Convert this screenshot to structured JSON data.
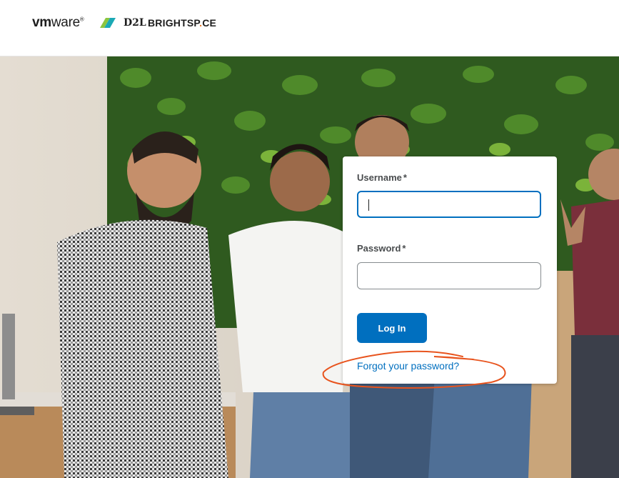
{
  "header": {
    "vmware_logo": {
      "bold": "vm",
      "regular": "ware",
      "mark": "®"
    },
    "d2l_logo": "D2L",
    "brightspace_logo": {
      "before": "BRIGHTSP",
      "dot": ".",
      "after": "CE"
    },
    "brand_colors": {
      "vmware_slash_green": "#8cc63f",
      "vmware_slash_teal": "#1ba9b5",
      "brightspace_orange": "#e87722"
    }
  },
  "login": {
    "username_label": "Username",
    "username_required": "*",
    "username_value": "",
    "password_label": "Password",
    "password_required": "*",
    "password_value": "",
    "login_button": "Log In",
    "forgot_link": "Forgot your password?",
    "accent_color": "#006fbf"
  },
  "annotation": {
    "color": "#e8541e",
    "shape": "hand-drawn ellipse around forgot password link"
  }
}
